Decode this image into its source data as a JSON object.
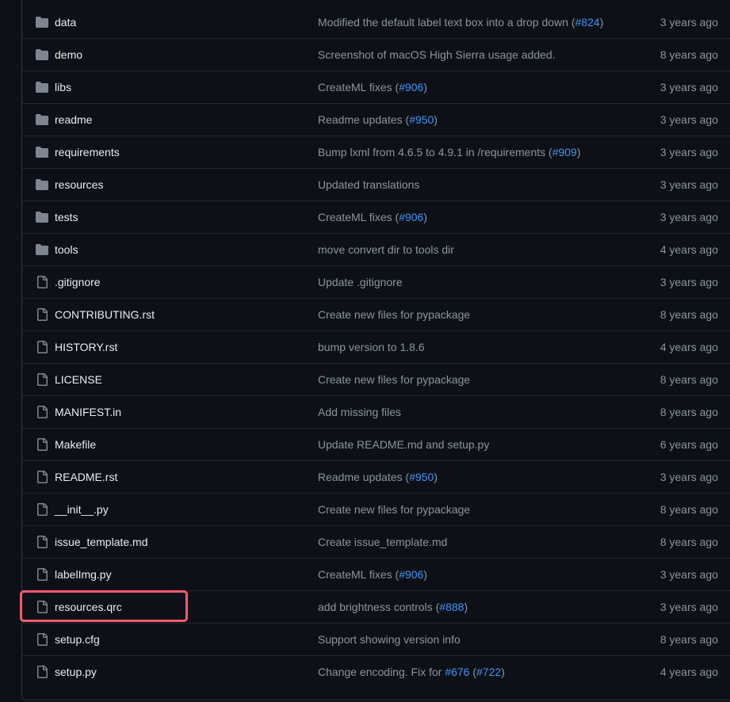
{
  "colors": {
    "background": "#0d1117",
    "folder_icon": "#7d8590",
    "file_icon": "#7d8590",
    "name_text": "#e6edf3",
    "muted_text": "#8b949e",
    "link": "#4493f8",
    "highlight_border": "#ff5a6e"
  },
  "files": [
    {
      "type": "folder",
      "icon": "folder-icon",
      "name": "data",
      "message": [
        {
          "t": "Modified the default label text box into a drop down ("
        },
        {
          "t": "#824",
          "link": true
        },
        {
          "t": ")"
        }
      ],
      "age": "3 years ago"
    },
    {
      "type": "folder",
      "icon": "folder-icon",
      "name": "demo",
      "message": [
        {
          "t": "Screenshot of macOS High Sierra usage added."
        }
      ],
      "age": "8 years ago"
    },
    {
      "type": "folder",
      "icon": "folder-icon",
      "name": "libs",
      "message": [
        {
          "t": "CreateML fixes ("
        },
        {
          "t": "#906",
          "link": true
        },
        {
          "t": ")"
        }
      ],
      "age": "3 years ago"
    },
    {
      "type": "folder",
      "icon": "folder-icon",
      "name": "readme",
      "message": [
        {
          "t": "Readme updates ("
        },
        {
          "t": "#950",
          "link": true
        },
        {
          "t": ")"
        }
      ],
      "age": "3 years ago"
    },
    {
      "type": "folder",
      "icon": "folder-icon",
      "name": "requirements",
      "message": [
        {
          "t": "Bump lxml from 4.6.5 to 4.9.1 in /requirements ("
        },
        {
          "t": "#909",
          "link": true
        },
        {
          "t": ")"
        }
      ],
      "age": "3 years ago"
    },
    {
      "type": "folder",
      "icon": "folder-icon",
      "name": "resources",
      "message": [
        {
          "t": "Updated translations"
        }
      ],
      "age": "3 years ago"
    },
    {
      "type": "folder",
      "icon": "folder-icon",
      "name": "tests",
      "message": [
        {
          "t": "CreateML fixes ("
        },
        {
          "t": "#906",
          "link": true
        },
        {
          "t": ")"
        }
      ],
      "age": "3 years ago"
    },
    {
      "type": "folder",
      "icon": "folder-icon",
      "name": "tools",
      "message": [
        {
          "t": "move convert dir to tools dir"
        }
      ],
      "age": "4 years ago"
    },
    {
      "type": "file",
      "icon": "file-icon",
      "name": ".gitignore",
      "message": [
        {
          "t": "Update .gitignore"
        }
      ],
      "age": "3 years ago"
    },
    {
      "type": "file",
      "icon": "file-icon",
      "name": "CONTRIBUTING.rst",
      "message": [
        {
          "t": "Create new files for pypackage"
        }
      ],
      "age": "8 years ago"
    },
    {
      "type": "file",
      "icon": "file-icon",
      "name": "HISTORY.rst",
      "message": [
        {
          "t": "bump version to 1.8.6"
        }
      ],
      "age": "4 years ago"
    },
    {
      "type": "file",
      "icon": "file-icon",
      "name": "LICENSE",
      "message": [
        {
          "t": "Create new files for pypackage"
        }
      ],
      "age": "8 years ago"
    },
    {
      "type": "file",
      "icon": "file-icon",
      "name": "MANIFEST.in",
      "message": [
        {
          "t": "Add missing files"
        }
      ],
      "age": "8 years ago"
    },
    {
      "type": "file",
      "icon": "file-icon",
      "name": "Makefile",
      "message": [
        {
          "t": "Update README.md and setup.py"
        }
      ],
      "age": "6 years ago"
    },
    {
      "type": "file",
      "icon": "file-icon",
      "name": "README.rst",
      "message": [
        {
          "t": "Readme updates ("
        },
        {
          "t": "#950",
          "link": true
        },
        {
          "t": ")"
        }
      ],
      "age": "3 years ago"
    },
    {
      "type": "file",
      "icon": "file-icon",
      "name": "__init__.py",
      "message": [
        {
          "t": "Create new files for pypackage"
        }
      ],
      "age": "8 years ago"
    },
    {
      "type": "file",
      "icon": "file-icon",
      "name": "issue_template.md",
      "message": [
        {
          "t": "Create issue_template.md"
        }
      ],
      "age": "8 years ago"
    },
    {
      "type": "file",
      "icon": "file-icon",
      "name": "labelImg.py",
      "message": [
        {
          "t": "CreateML fixes ("
        },
        {
          "t": "#906",
          "link": true
        },
        {
          "t": ")"
        }
      ],
      "age": "3 years ago"
    },
    {
      "type": "file",
      "icon": "file-icon",
      "name": "resources.qrc",
      "highlighted": true,
      "message": [
        {
          "t": "add brightness controls ("
        },
        {
          "t": "#888",
          "link": true
        },
        {
          "t": ")"
        }
      ],
      "age": "3 years ago"
    },
    {
      "type": "file",
      "icon": "file-icon",
      "name": "setup.cfg",
      "message": [
        {
          "t": "Support showing version info"
        }
      ],
      "age": "8 years ago"
    },
    {
      "type": "file",
      "icon": "file-icon",
      "name": "setup.py",
      "message": [
        {
          "t": "Change encoding. Fix for "
        },
        {
          "t": "#676",
          "link": true
        },
        {
          "t": " ("
        },
        {
          "t": "#722",
          "link": true
        },
        {
          "t": ")"
        }
      ],
      "age": "4 years ago"
    }
  ]
}
